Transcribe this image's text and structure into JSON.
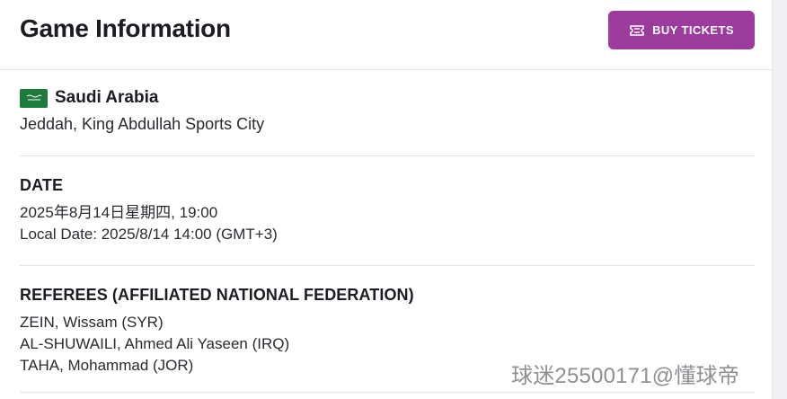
{
  "header": {
    "title": "Game Information",
    "buy_tickets_label": "BUY TICKETS"
  },
  "location": {
    "country": "Saudi Arabia",
    "flag_icon": "saudi-arabia-flag-icon",
    "venue": "Jeddah, King Abdullah Sports City"
  },
  "date": {
    "label": "DATE",
    "lines": [
      "2025年8月14日星期四, 19:00",
      "Local Date: 2025/8/14 14:00 (GMT+3)"
    ]
  },
  "referees": {
    "label": "REFEREES (AFFILIATED NATIONAL FEDERATION)",
    "names": [
      "ZEIN, Wissam (SYR)",
      "AL-SHUWAILI, Ahmed Ali Yaseen (IRQ)",
      "TAHA, Mohammad (JOR)"
    ]
  },
  "watermark": "球迷25500171@懂球帝",
  "colors": {
    "accent": "#9b3b9b",
    "flag_green": "#1f7a3e",
    "divider": "#e6e6ea",
    "text": "#1c1c22"
  }
}
